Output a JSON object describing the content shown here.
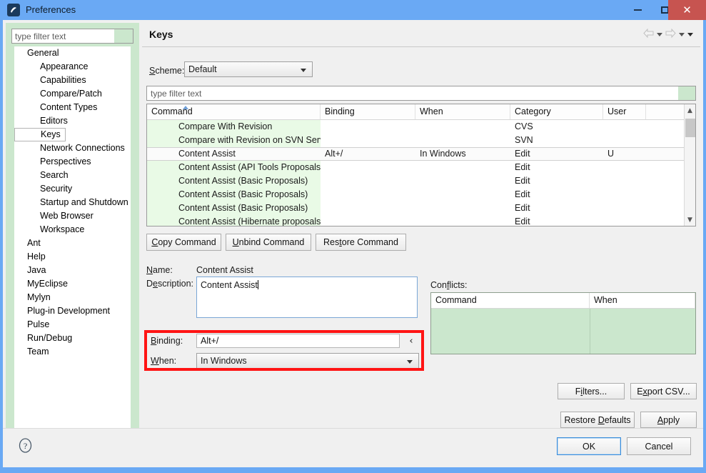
{
  "window": {
    "title": "Preferences",
    "icon": "eclipse-icon",
    "controls": {
      "minimize": "minimize-icon",
      "maximize": "maximize-icon",
      "close": "close-icon",
      "close_color": "#c75450"
    },
    "frame_color": "#6aa9f4"
  },
  "sidebar": {
    "filter_placeholder": "type filter text",
    "filter_value": "",
    "selected": "Keys",
    "items": [
      {
        "label": "General",
        "level": 0
      },
      {
        "label": "Appearance",
        "level": 1
      },
      {
        "label": "Capabilities",
        "level": 1
      },
      {
        "label": "Compare/Patch",
        "level": 1
      },
      {
        "label": "Content Types",
        "level": 1
      },
      {
        "label": "Editors",
        "level": 1
      },
      {
        "label": "Keys",
        "level": 1
      },
      {
        "label": "Network Connections",
        "level": 1
      },
      {
        "label": "Perspectives",
        "level": 1
      },
      {
        "label": "Search",
        "level": 1
      },
      {
        "label": "Security",
        "level": 1
      },
      {
        "label": "Startup and Shutdown",
        "level": 1
      },
      {
        "label": "Web Browser",
        "level": 1
      },
      {
        "label": "Workspace",
        "level": 1
      },
      {
        "label": "Ant",
        "level": 0
      },
      {
        "label": "Help",
        "level": 0
      },
      {
        "label": "Java",
        "level": 0
      },
      {
        "label": "MyEclipse",
        "level": 0
      },
      {
        "label": "Mylyn",
        "level": 0
      },
      {
        "label": "Plug-in Development",
        "level": 0
      },
      {
        "label": "Pulse",
        "level": 0
      },
      {
        "label": "Run/Debug",
        "level": 0
      },
      {
        "label": "Team",
        "level": 0
      }
    ]
  },
  "page": {
    "title": "Keys",
    "nav": {
      "back_icon": "back-arrow-icon",
      "back_menu_icon": "chevron-down-icon",
      "forward_icon": "forward-arrow-icon",
      "forward_menu_icon": "chevron-down-icon",
      "more_icon": "chevron-down-icon"
    },
    "scheme": {
      "label": "Scheme:",
      "label_mnemonic": "S",
      "value": "Default",
      "caret_icon": "chevron-down-icon"
    },
    "table_filter_placeholder": "type filter text",
    "table_filter_value": ""
  },
  "bindings_table": {
    "columns": [
      "Command",
      "Binding",
      "When",
      "Category",
      "User"
    ],
    "sort_column": "Command",
    "sort_icon": "sort-ascending-icon",
    "rows": [
      {
        "command": "Compare With Revision",
        "binding": "",
        "when": "",
        "category": "CVS",
        "user": "",
        "selected": false
      },
      {
        "command": "Compare with Revision on SVN Server",
        "binding": "",
        "when": "",
        "category": "SVN",
        "user": "",
        "selected": false
      },
      {
        "command": "Content Assist",
        "binding": "Alt+/",
        "when": "In Windows",
        "category": "Edit",
        "user": "U",
        "selected": true
      },
      {
        "command": "Content Assist (API Tools Proposals)",
        "binding": "",
        "when": "",
        "category": "Edit",
        "user": "",
        "selected": false
      },
      {
        "command": "Content Assist (Basic Proposals)",
        "binding": "",
        "when": "",
        "category": "Edit",
        "user": "",
        "selected": false
      },
      {
        "command": "Content Assist (Basic Proposals)",
        "binding": "",
        "when": "",
        "category": "Edit",
        "user": "",
        "selected": false
      },
      {
        "command": "Content Assist (Basic Proposals)",
        "binding": "",
        "when": "",
        "category": "Edit",
        "user": "",
        "selected": false
      },
      {
        "command": "Content Assist (Hibernate proposals)",
        "binding": "",
        "when": "",
        "category": "Edit",
        "user": "",
        "selected": false
      }
    ],
    "scrollbar": {
      "up_icon": "chevron-up-icon",
      "down_icon": "chevron-down-icon"
    },
    "row_highlight_color": "#e9fae6"
  },
  "command_buttons": {
    "copy": {
      "pre": "C",
      "mn": "",
      "post": "opy Command",
      "label": "Copy Command"
    },
    "unbind": {
      "label": "Unbind Command"
    },
    "restore": {
      "label": "Restore Command"
    }
  },
  "details": {
    "name_label": "Name:",
    "name_value": "Content Assist",
    "description_label": "Description:",
    "description_value": "Content Assist",
    "binding_label": "Binding:",
    "binding_value": "Alt+/",
    "binding_prev_icon": "chevron-left-icon",
    "when_label": "When:",
    "when_value": "In Windows",
    "when_caret_icon": "chevron-down-icon",
    "highlight_color": "#ff1414"
  },
  "conflicts": {
    "label": "Conflicts:",
    "columns": [
      "Command",
      "When"
    ],
    "rows": [],
    "body_color": "#cbe7cd"
  },
  "action_buttons": {
    "filters": "Filters...",
    "export_csv": "Export CSV...",
    "restore_defaults": "Restore Defaults",
    "apply": "Apply"
  },
  "footer": {
    "help_icon": "help-question-icon",
    "ok": "OK",
    "cancel": "Cancel"
  }
}
